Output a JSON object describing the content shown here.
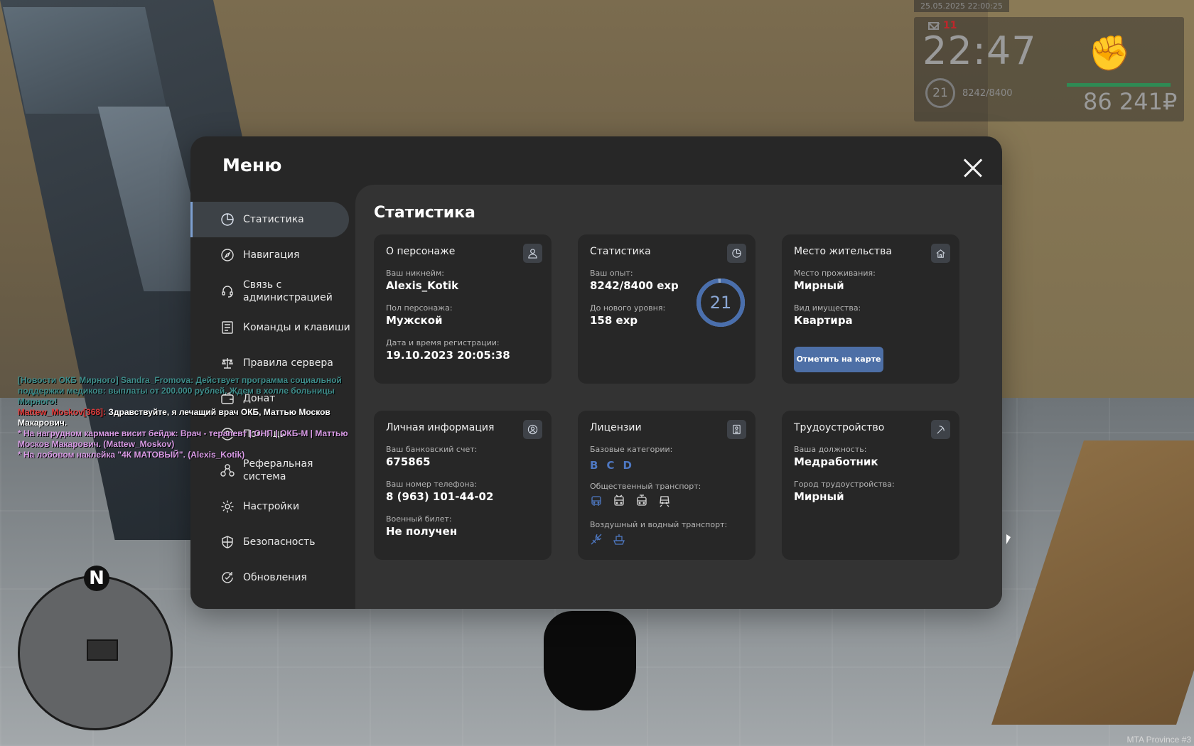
{
  "hud": {
    "datetime": "25.05.2025 22:00:25",
    "mail_count": "11",
    "clock": "22:47",
    "level": "21",
    "exp": "8242/8400",
    "money": "86 241₽"
  },
  "chat": [
    {
      "prefix": "",
      "text": "[Новости ОКБ Мирного] Sandra_Fromova: Действует программа социальной поддержки медиков: выплаты от 200.000 рублей. Ждем в холле больницы Мирного!",
      "style": "news"
    },
    {
      "prefix": "Mattew_Moskov[368]:",
      "text": " Здравствуйте, я лечащий врач ОКБ, Маттью Москов Макарович.",
      "style": "say"
    },
    {
      "prefix": "",
      "text": "* На нагрудном кармане висит бейдж: Врач - терапевт | ОНП | ОКБ-М | Маттью Москов Макарович. (Mattew_Moskov)",
      "style": "me"
    },
    {
      "prefix": "",
      "text": "* На лобовом наклейка \"4К МАТОВЫЙ\". (Alexis_Kotik)",
      "style": "me"
    }
  ],
  "minimap": {
    "north": "N"
  },
  "watermark": "MTA Province #3",
  "menu": {
    "title": "Меню",
    "nav": [
      {
        "label": "Статистика",
        "icon": "pie-chart-icon",
        "active": true
      },
      {
        "label": "Навигация",
        "icon": "compass-icon"
      },
      {
        "label": "Связь с администрацией",
        "icon": "headset-icon"
      },
      {
        "label": "Команды и клавиши",
        "icon": "list-icon"
      },
      {
        "label": "Правила сервера",
        "icon": "scales-icon"
      },
      {
        "label": "Донат",
        "icon": "wallet-icon"
      },
      {
        "label": "Помощь",
        "icon": "help-icon"
      },
      {
        "label": "Реферальная система",
        "icon": "referral-icon"
      },
      {
        "label": "Настройки",
        "icon": "gear-icon"
      },
      {
        "label": "Безопасность",
        "icon": "shield-icon"
      },
      {
        "label": "Обновления",
        "icon": "refresh-icon"
      }
    ],
    "content_title": "Статистика",
    "about": {
      "title": "О персонаже",
      "nick_label": "Ваш никнейм:",
      "nick": "Alexis_Kotik",
      "gender_label": "Пол персонажа:",
      "gender": "Мужской",
      "reg_label": "Дата и время регистрации:",
      "reg": "19.10.2023 20:05:38"
    },
    "stats": {
      "title": "Статистика",
      "exp_label": "Ваш опыт:",
      "exp": "8242/8400 exp",
      "next_label": "До нового уровня:",
      "next": "158 exp",
      "level": "21",
      "level_progress": 0.981
    },
    "residence": {
      "title": "Место жительства",
      "city_label": "Место проживания:",
      "city": "Мирный",
      "property_label": "Вид имущества:",
      "property": "Квартира",
      "map_button": "Отметить на карте"
    },
    "personal": {
      "title": "Личная информация",
      "bank_label": "Ваш банковский счет:",
      "bank": "675865",
      "phone_label": "Ваш номер телефона:",
      "phone": "8 (963) 101-44-02",
      "military_label": "Военный билет:",
      "military": "Не получен"
    },
    "licenses": {
      "title": "Лицензии",
      "base_label": "Базовые категории:",
      "categories": [
        "B",
        "C",
        "D"
      ],
      "public_label": "Общественный транспорт:",
      "public_icons": [
        "bus-icon",
        "trolleybus-icon",
        "tram-icon",
        "metro-icon"
      ],
      "air_water_label": "Воздушный и водный транспорт:",
      "air_water_icons": [
        "plane-icon",
        "ship-icon"
      ]
    },
    "job": {
      "title": "Трудоустройство",
      "position_label": "Ваша должность:",
      "position": "Медработник",
      "city_label": "Город трудоустройства:",
      "city": "Мирный"
    }
  }
}
